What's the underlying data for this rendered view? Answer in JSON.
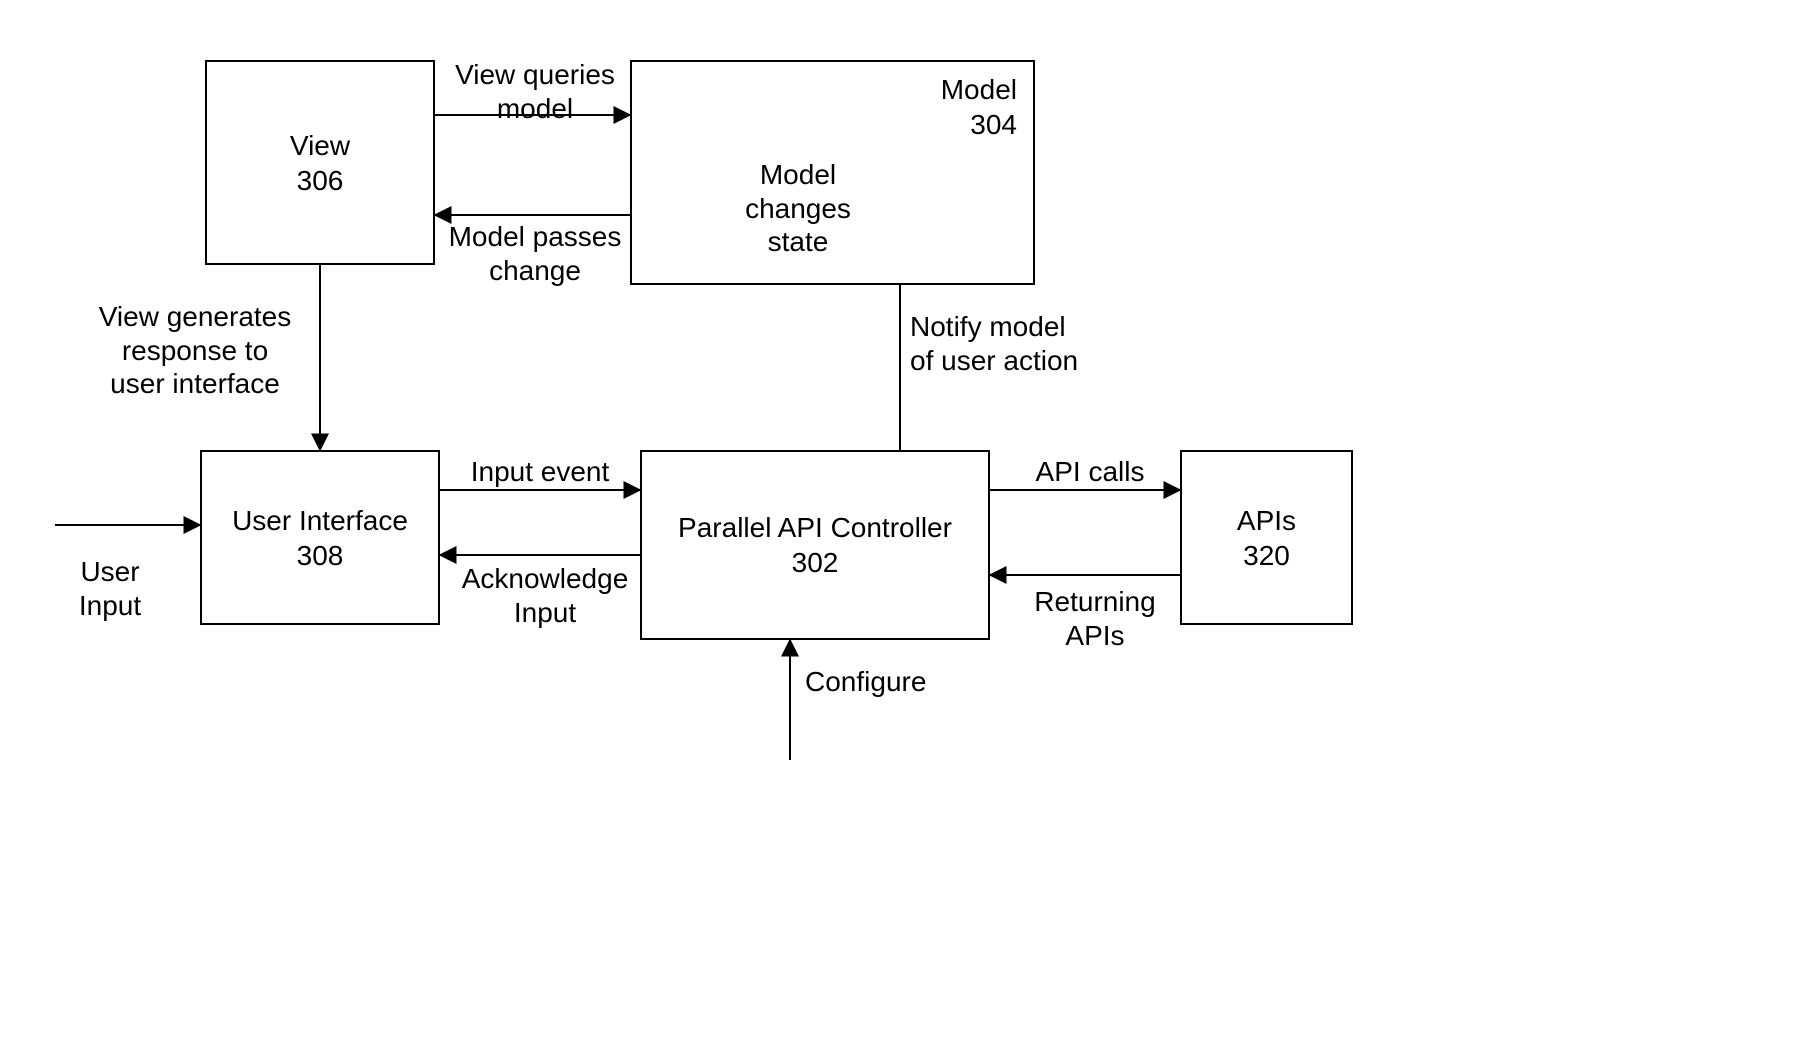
{
  "boxes": {
    "view": {
      "title": "View",
      "num": "306"
    },
    "model": {
      "title": "Model",
      "num": "304"
    },
    "ui": {
      "title": "User Interface",
      "num": "308"
    },
    "controller": {
      "title": "Parallel API Controller",
      "num": "302"
    },
    "apis": {
      "title": "APIs",
      "num": "320"
    }
  },
  "labels": {
    "view_queries_model": "View queries\nmodel",
    "model_passes_change": "Model passes\nchange",
    "model_changes_state": "Model\nchanges\nstate",
    "view_generates": "View generates\nresponse to\nuser interface",
    "notify_model": "Notify model\nof user action",
    "input_event": "Input event",
    "ack_input": "Acknowledge\nInput",
    "api_calls": "API calls",
    "returning_apis": "Returning\nAPIs",
    "user_input": "User\nInput",
    "configure": "Configure"
  }
}
